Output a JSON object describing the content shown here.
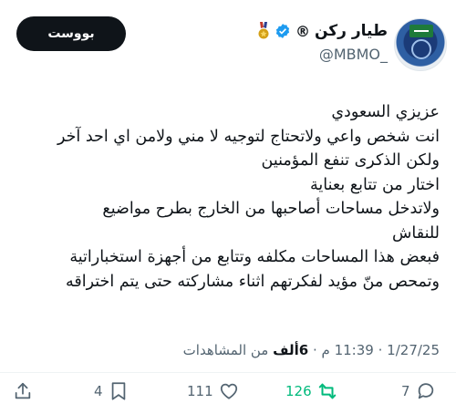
{
  "user": {
    "name": "طيار ركن",
    "reg_mark": "®",
    "handle": "@MBMO_"
  },
  "follow_button_label": "بووست",
  "tweet_lines": [
    "عزيزي السعودي",
    "انت شخص واعي ولاتحتاج لتوجيه لا مني ولامن اي احد آخر",
    "ولكن الذكرى تنفع المؤمنين",
    "اختار من تتابع بعناية",
    "ولاتدخل مساحات أصاحبها من الخارج بطرح مواضيع",
    "للنقاش",
    "فبعض هذا المساحات مكلفه وتتابع من أجهزة استخباراتية",
    "وتمحص منّ مؤيد لفكرتهم اثناء مشاركته حتى يتم اختراقه"
  ],
  "meta": {
    "time": "11:39 م",
    "date": "1/27/25",
    "separator": "·",
    "views_count": "6ألف",
    "views_label": "من المشاهدات"
  },
  "actions": {
    "replies": "7",
    "retweets": "126",
    "likes": "111",
    "bookmarks": "4"
  },
  "colors": {
    "verified": "#1d9bf0",
    "retweet_active": "#00ba7c",
    "muted": "#536471"
  },
  "icons": [
    "verified-badge-icon",
    "medal-icon",
    "reply-icon",
    "retweet-icon",
    "like-icon",
    "bookmark-icon",
    "share-icon"
  ]
}
